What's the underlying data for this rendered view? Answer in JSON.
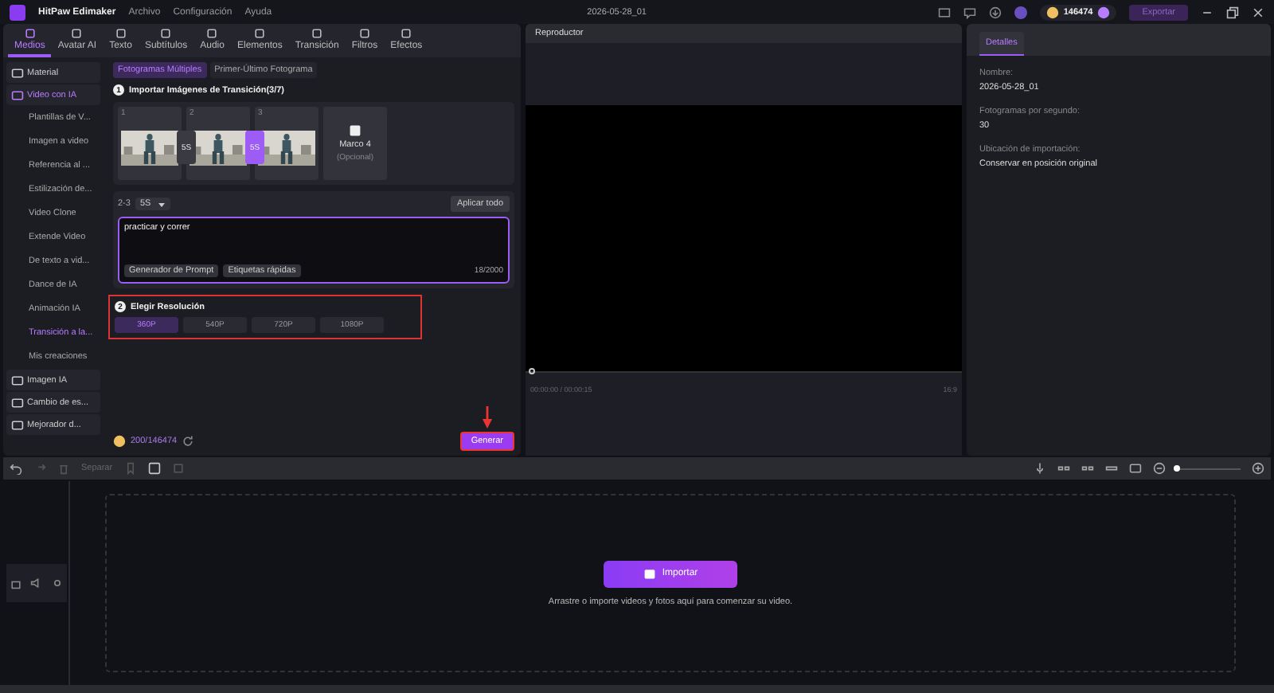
{
  "app": {
    "name": "HitPaw Edimaker",
    "menu": [
      "Archivo",
      "Configuración",
      "Ayuda"
    ],
    "project": "2026-05-28_01",
    "coins": "146474",
    "export": "Exportar"
  },
  "tools": [
    {
      "label": "Medios",
      "selected": true
    },
    {
      "label": "Avatar AI",
      "selected": false
    },
    {
      "label": "Texto",
      "selected": false
    },
    {
      "label": "Subtítulos",
      "selected": false
    },
    {
      "label": "Audio",
      "selected": false
    },
    {
      "label": "Elementos",
      "selected": false
    },
    {
      "label": "Transición",
      "selected": false
    },
    {
      "label": "Filtros",
      "selected": false
    },
    {
      "label": "Efectos",
      "selected": false
    }
  ],
  "sidebar": [
    {
      "label": "Material",
      "kind": "group",
      "selected": false
    },
    {
      "label": "Video con IA",
      "kind": "group",
      "selected": true
    },
    {
      "label": "Plantillas de V...",
      "kind": "item",
      "selected": false
    },
    {
      "label": "Imagen a video",
      "kind": "item",
      "selected": false
    },
    {
      "label": "Referencia al ...",
      "kind": "item",
      "selected": false
    },
    {
      "label": "Estilización de...",
      "kind": "item",
      "selected": false
    },
    {
      "label": "Video Clone",
      "kind": "item",
      "selected": false
    },
    {
      "label": "Extende Video",
      "kind": "item",
      "selected": false
    },
    {
      "label": "De texto a vid...",
      "kind": "item",
      "selected": false
    },
    {
      "label": "Dance de IA",
      "kind": "item",
      "selected": false
    },
    {
      "label": "Animación IA",
      "kind": "item",
      "selected": false
    },
    {
      "label": "Transición a la...",
      "kind": "item",
      "selected": true
    },
    {
      "label": "Mis creaciones",
      "kind": "item",
      "selected": false
    },
    {
      "label": "Imagen IA",
      "kind": "group",
      "selected": false
    },
    {
      "label": "Cambio de es...",
      "kind": "group",
      "selected": false
    },
    {
      "label": "Mejorador d...",
      "kind": "group",
      "selected": false
    }
  ],
  "mode_tabs": [
    {
      "label": "Fotogramas Múltiples",
      "selected": true
    },
    {
      "label": "Primer-Último Fotograma",
      "selected": false
    }
  ],
  "import": {
    "step": "1",
    "title": "Importar Imágenes de Transición(3/7)"
  },
  "frames": [
    {
      "number": "1"
    },
    {
      "number": "2"
    },
    {
      "number": "3"
    }
  ],
  "transitions": [
    {
      "duration": "5S",
      "selected": false
    },
    {
      "duration": "5S",
      "selected": true
    }
  ],
  "add_frame": {
    "label": "Marco 4",
    "note": "(Opcional)"
  },
  "segment": {
    "range": "2-3",
    "duration": "5S",
    "apply": "Aplicar todo"
  },
  "prompt": {
    "value": "practicar y correr",
    "generator": "Generador de Prompt",
    "tags": "Etiquetas rápidas",
    "counter": "18/2000"
  },
  "resolution": {
    "step": "2",
    "title": "Elegir Resolución",
    "options": [
      {
        "label": "360P",
        "selected": true
      },
      {
        "label": "540P",
        "selected": false
      },
      {
        "label": "720P",
        "selected": false
      },
      {
        "label": "1080P",
        "selected": false
      }
    ]
  },
  "credits": "200/146474",
  "generate": "Generar",
  "player": {
    "title": "Reproductor",
    "time": "00:00:00 / 00:00:15",
    "ratio": "16:9"
  },
  "details": {
    "tab": "Detalles",
    "fields": [
      {
        "label": "Nombre:",
        "value": "2026-05-28_01"
      },
      {
        "label": "Fotogramas por segundo:",
        "value": "30"
      },
      {
        "label": "Ubicación de importación:",
        "value": "Conservar en posición original"
      }
    ]
  },
  "timeline": {
    "zoom": {
      "level": 0
    },
    "split": "Separar",
    "import": "Importar",
    "hint": "Arrastre o importe videos y fotos aquí para comenzar su video."
  }
}
